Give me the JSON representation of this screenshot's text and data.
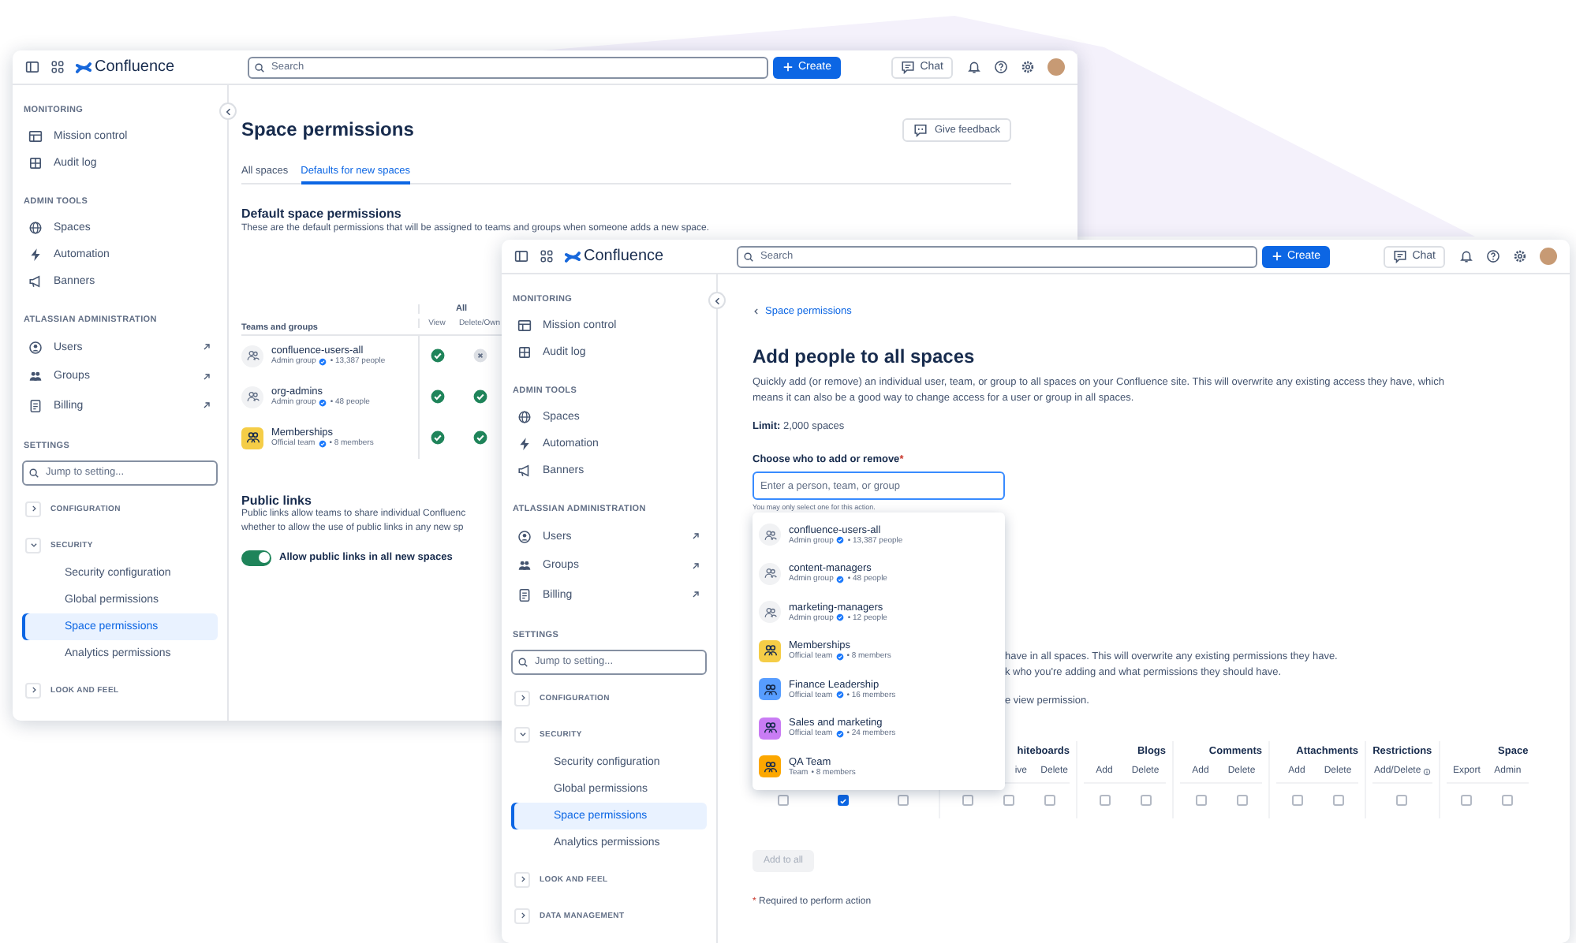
{
  "windows": [
    {
      "topbar": {
        "product": "Confluence",
        "search_placeholder": "Search",
        "create_label": "Create",
        "chat_label": "Chat"
      },
      "sidebar": {
        "groups": [
          {
            "heading": "MONITORING",
            "items": [
              {
                "label": "Mission control",
                "external": false
              },
              {
                "label": "Audit log",
                "external": false
              }
            ]
          },
          {
            "heading": "ADMIN TOOLS",
            "items": [
              {
                "label": "Spaces",
                "external": false
              },
              {
                "label": "Automation",
                "external": false
              },
              {
                "label": "Banners",
                "external": false
              }
            ]
          },
          {
            "heading": "ATLASSIAN ADMINISTRATION",
            "items": [
              {
                "label": "Users",
                "external": true
              },
              {
                "label": "Groups",
                "external": true
              },
              {
                "label": "Billing",
                "external": true
              }
            ]
          }
        ],
        "settings_heading": "SETTINGS",
        "search_placeholder": "Jump to setting...",
        "sections": [
          {
            "label": "CONFIGURATION",
            "expanded": false
          },
          {
            "label": "SECURITY",
            "expanded": true,
            "items": [
              {
                "label": "Security configuration",
                "selected": false
              },
              {
                "label": "Global permissions",
                "selected": false
              },
              {
                "label": "Space permissions",
                "selected": true
              },
              {
                "label": "Analytics permissions",
                "selected": false
              }
            ]
          },
          {
            "label": "LOOK AND FEEL",
            "expanded": false
          }
        ]
      },
      "page": {
        "kind": "default_permissions",
        "title": "Space permissions",
        "feedback_label": "Give feedback",
        "tabs": [
          {
            "label": "All spaces",
            "selected": false
          },
          {
            "label": "Defaults for new spaces",
            "selected": true
          }
        ],
        "section_title": "Default space permissions",
        "section_text": "These are the default permissions that will be assigned to teams and groups when someone adds a new space.",
        "table": {
          "group_header": "All",
          "name_header": "Teams and groups",
          "view_header": "View",
          "delete_header": "Delete/Own",
          "rows": [
            {
              "kind": "group",
              "name": "confluence-users-all",
              "type": "Admin group",
              "verified": true,
              "count": "• 13,387 people",
              "view": true,
              "delete_own": false
            },
            {
              "kind": "group",
              "name": "org-admins",
              "type": "Admin group",
              "verified": true,
              "count": "• 48 people",
              "view": true,
              "delete_own": true
            },
            {
              "kind": "team",
              "color": "#f5cd47",
              "name": "Memberships",
              "type": "Official team",
              "verified": true,
              "count": "• 8 members",
              "view": true,
              "delete_own": true
            }
          ]
        },
        "public_links": {
          "title": "Public links",
          "lines": [
            "Public links allow teams to share individual Confluenc",
            "whether to allow the use of public links in any new sp"
          ],
          "toggle_label": "Allow public links in all new spaces",
          "on": true
        }
      }
    },
    {
      "topbar": {
        "product": "Confluence",
        "search_placeholder": "Search",
        "create_label": "Create",
        "chat_label": "Chat"
      },
      "sidebar": {
        "groups": [
          {
            "heading": "MONITORING",
            "items": [
              {
                "label": "Mission control",
                "external": false
              },
              {
                "label": "Audit log",
                "external": false
              }
            ]
          },
          {
            "heading": "ADMIN TOOLS",
            "items": [
              {
                "label": "Spaces",
                "external": false
              },
              {
                "label": "Automation",
                "external": false
              },
              {
                "label": "Banners",
                "external": false
              }
            ]
          },
          {
            "heading": "ATLASSIAN ADMINISTRATION",
            "items": [
              {
                "label": "Users",
                "external": true
              },
              {
                "label": "Groups",
                "external": true
              },
              {
                "label": "Billing",
                "external": true
              }
            ]
          }
        ],
        "settings_heading": "SETTINGS",
        "search_placeholder": "Jump to setting...",
        "sections": [
          {
            "label": "CONFIGURATION",
            "expanded": false
          },
          {
            "label": "SECURITY",
            "expanded": true,
            "items": [
              {
                "label": "Security configuration",
                "selected": false
              },
              {
                "label": "Global permissions",
                "selected": false
              },
              {
                "label": "Space permissions",
                "selected": true
              },
              {
                "label": "Analytics permissions",
                "selected": false
              }
            ]
          },
          {
            "label": "LOOK AND FEEL",
            "expanded": false
          },
          {
            "label": "DATA MANAGEMENT",
            "expanded": false
          }
        ]
      },
      "page": {
        "kind": "add_people",
        "back_link": "Space permissions",
        "title": "Add people to all spaces",
        "description": "Quickly add (or remove) an individual user, team, or group to all spaces on your Confluence site. This will overwrite any existing access they have, which means it can also be a good way to change access for a user or group in all spaces.",
        "limit": "**Limit:** 2,000 spaces",
        "field_label": "Choose who to add or remove",
        "required_mark": "*",
        "field_placeholder": "Enter a person, team, or group",
        "field_hint": "You may only select one for this action.",
        "dropdown": [
          {
            "kind": "group",
            "name": "confluence-users-all",
            "type": "Admin group",
            "verified": true,
            "count": "• 13,387 people"
          },
          {
            "kind": "group",
            "name": "content-managers",
            "type": "Admin group",
            "verified": true,
            "count": "• 48 people"
          },
          {
            "kind": "group",
            "name": "marketing-managers",
            "type": "Admin group",
            "verified": true,
            "count": "• 12 people"
          },
          {
            "kind": "team",
            "color": "#f5cd47",
            "name": "Memberships",
            "type": "Official team",
            "verified": true,
            "count": "• 8 members"
          },
          {
            "kind": "team",
            "color": "#579dff",
            "name": "Finance Leadership",
            "type": "Official team",
            "verified": true,
            "count": "• 16 members"
          },
          {
            "kind": "team",
            "color": "#c97cf4",
            "name": "Sales and marketing",
            "type": "Official team",
            "verified": true,
            "count": "• 24 members"
          },
          {
            "kind": "team",
            "color": "#fca700",
            "name": "QA Team",
            "type": "Team",
            "verified": false,
            "count": "• 8 members"
          }
        ],
        "partial_lines": [
          "have in all spaces. This will overwrite any existing permissions they have.",
          "k who you're adding and what permissions they should have.",
          "e view permission."
        ],
        "permission_groups": [
          {
            "columns": [
              {
                "checked": false
              },
              {
                "checked": true
              },
              {
                "checked": false
              }
            ]
          },
          {
            "label": "hiteboards",
            "columns": [
              {
                "checked": false
              },
              {
                "subheader": "ive",
                "checked": false
              },
              {
                "subheader": "Delete",
                "checked": false
              }
            ]
          },
          {
            "label": "Blogs",
            "columns": [
              {
                "subheader": "Add",
                "checked": false
              },
              {
                "subheader": "Delete",
                "checked": false
              }
            ]
          },
          {
            "label": "Comments",
            "columns": [
              {
                "subheader": "Add",
                "checked": false
              },
              {
                "subheader": "Delete",
                "checked": false
              }
            ]
          },
          {
            "label": "Attachments",
            "columns": [
              {
                "subheader": "Add",
                "checked": false
              },
              {
                "subheader": "Delete",
                "checked": false
              }
            ]
          },
          {
            "label": "Restrictions",
            "columns": [
              {
                "subheader": "Add/Delete",
                "info": true,
                "checked": false
              }
            ]
          },
          {
            "label": "Space",
            "columns": [
              {
                "subheader": "Export",
                "checked": false
              },
              {
                "subheader": "Admin",
                "checked": false
              }
            ]
          }
        ],
        "add_label": "Add to all",
        "add_disabled": true,
        "required_note_mark": "*",
        "required_note": "Required to perform action"
      }
    }
  ]
}
